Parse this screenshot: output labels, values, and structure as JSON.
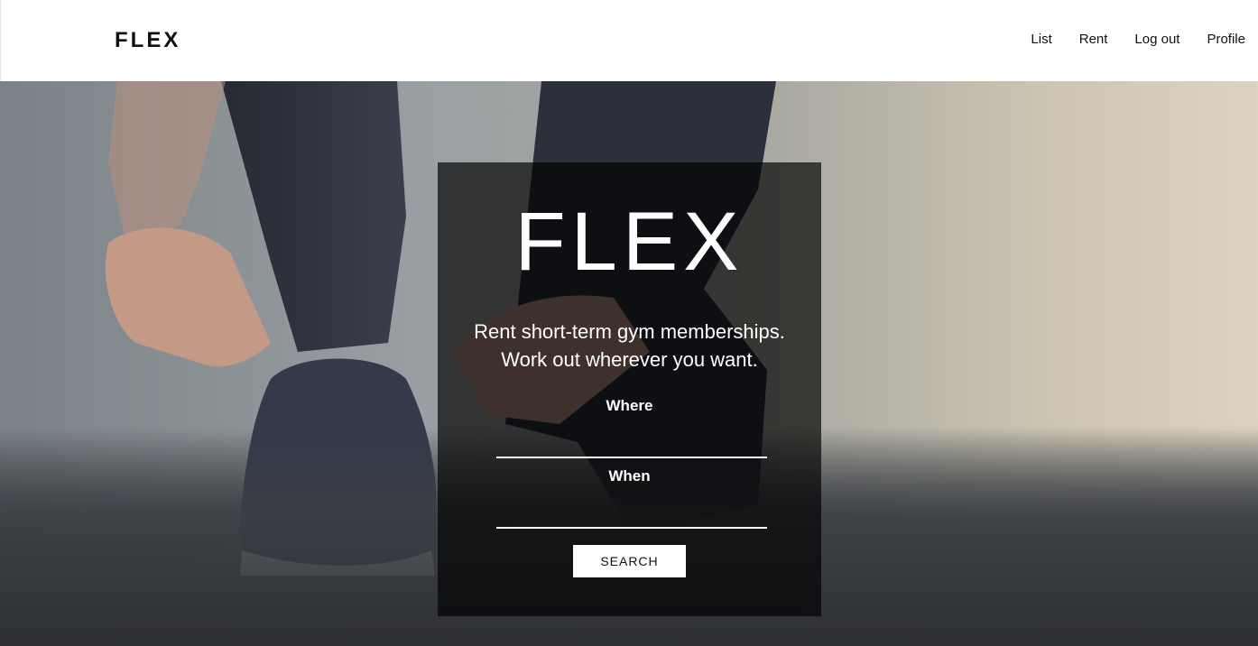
{
  "header": {
    "brand": "FLEX",
    "nav": [
      {
        "label": "List"
      },
      {
        "label": "Rent"
      },
      {
        "label": "Log out"
      },
      {
        "label": "Profile"
      }
    ]
  },
  "hero": {
    "title": "FLEX",
    "tagline_line1": "Rent short-term gym memberships.",
    "tagline_line2": "Work out wherever you want.",
    "where": {
      "label": "Where",
      "value": ""
    },
    "when": {
      "label": "When",
      "value": ""
    },
    "search_label": "SEARCH"
  }
}
